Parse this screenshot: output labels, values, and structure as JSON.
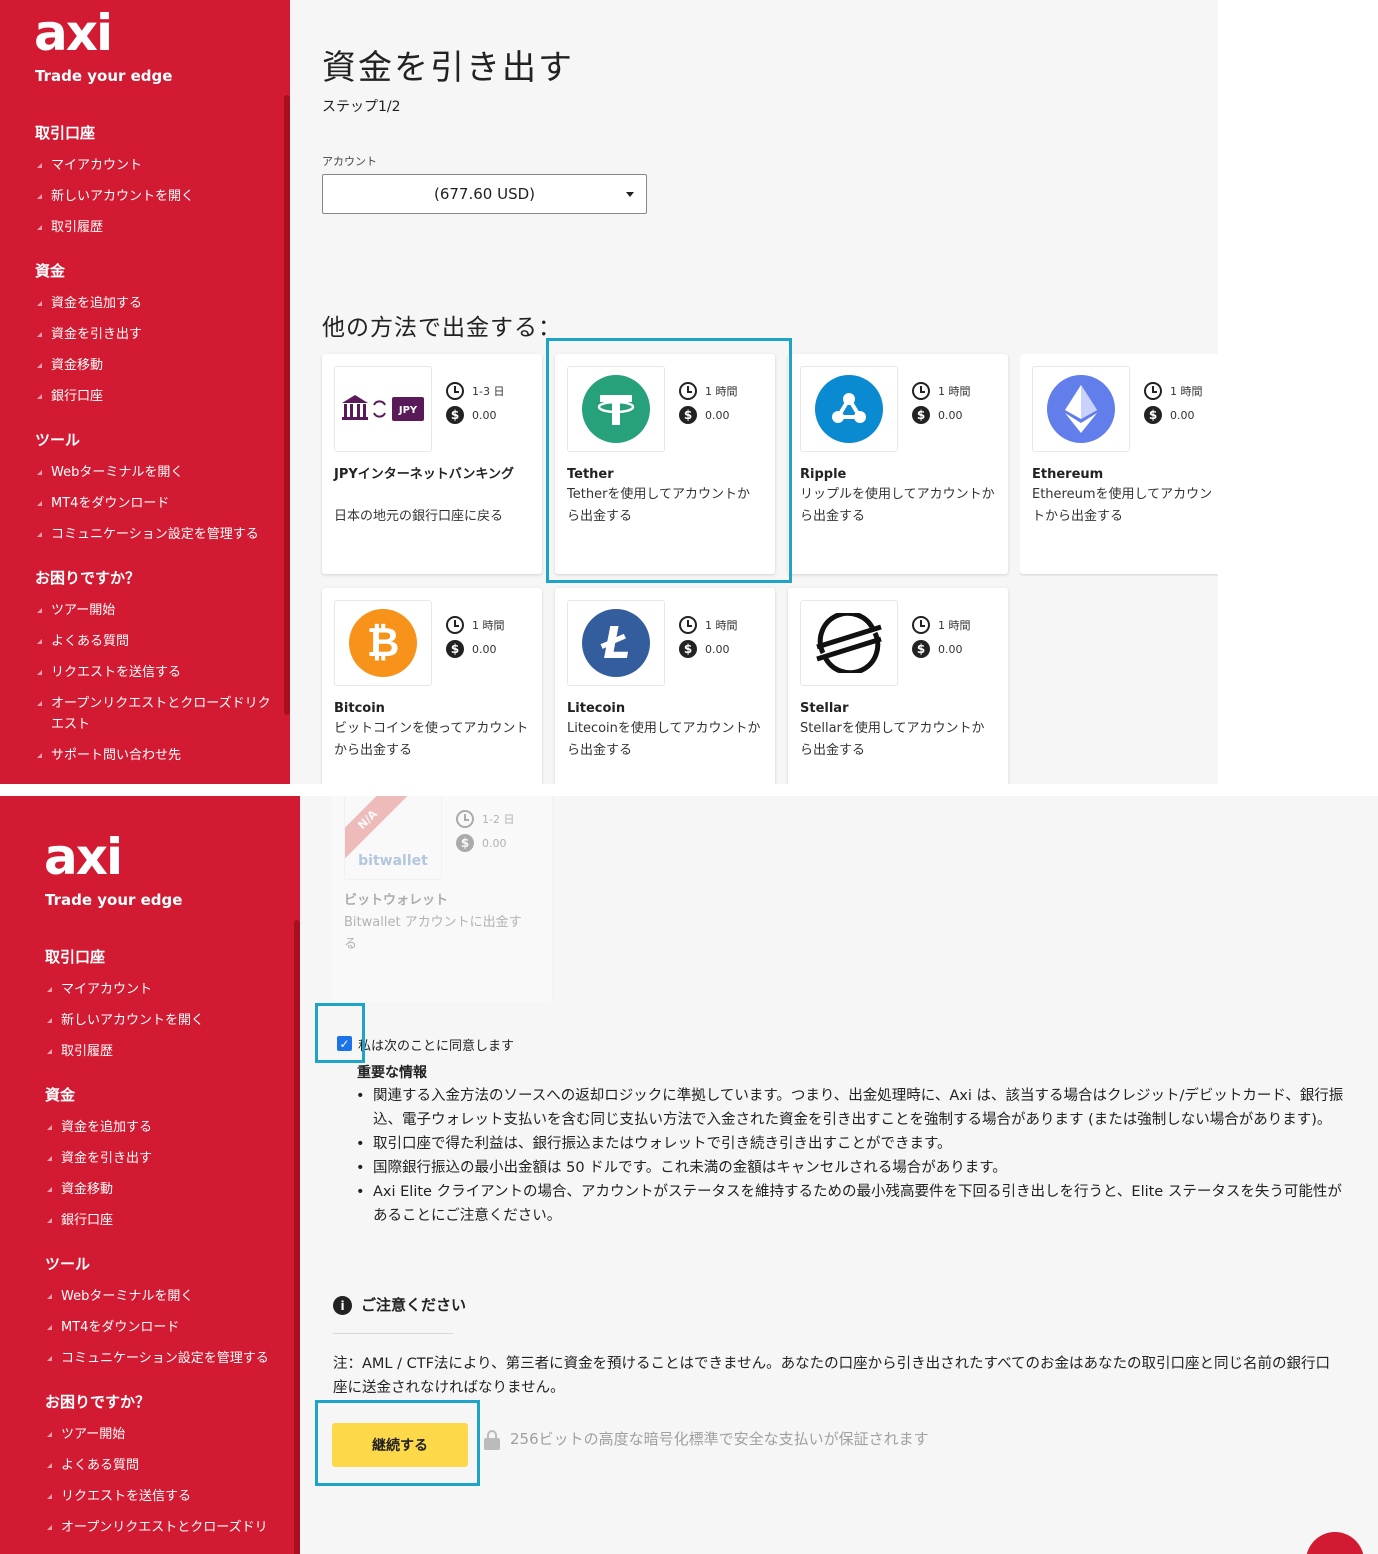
{
  "brand": {
    "logo": "axi",
    "tagline": "Trade your edge"
  },
  "sidebar": [
    {
      "section": "取引口座",
      "items": [
        "マイアカウント",
        "新しいアカウントを開く",
        "取引履歴"
      ]
    },
    {
      "section": "資金",
      "items": [
        "資金を追加する",
        "資金を引き出す",
        "資金移動",
        "銀行口座"
      ]
    },
    {
      "section": "ツール",
      "items": [
        "Webターミナルを開く",
        "MT4をダウンロード",
        "コミュニケーション設定を管理する"
      ]
    },
    {
      "section": "お困りですか？",
      "items": [
        "ツアー開始",
        "よくある質問",
        "リクエストを送信する",
        "オープンリクエストとクローズドリクエスト",
        "サポート問い合わせ先"
      ]
    }
  ],
  "sidebar2_last": "オープンリクエストとクローズドリ",
  "page": {
    "title": "資金を引き出す",
    "step": "ステップ1/2",
    "account_label": "アカウント",
    "account_value": "(677.60 USD)",
    "other_methods_title": "他の方法で出金する："
  },
  "methods": [
    {
      "name": "JPYインターネットバンキング",
      "desc": "日本の地元の銀行口座に戻る",
      "time": "1-3 日",
      "fee": "0.00",
      "icon": "bank-jpy-icon"
    },
    {
      "name": "Tether",
      "desc": "Tetherを使用してアカウントから出金する",
      "time": "1 時間",
      "fee": "0.00",
      "icon": "tether-icon"
    },
    {
      "name": "Ripple",
      "desc": "リップルを使用してアカウントから出金する",
      "time": "1 時間",
      "fee": "0.00",
      "icon": "ripple-icon"
    },
    {
      "name": "Ethereum",
      "desc": "Ethereumを使用してアカウントから出金する",
      "time": "1 時間",
      "fee": "0.00",
      "icon": "ethereum-icon"
    },
    {
      "name": "Bitcoin",
      "desc": "ビットコインを使ってアカウントから出金する",
      "time": "1 時間",
      "fee": "0.00",
      "icon": "bitcoin-icon"
    },
    {
      "name": "Litecoin",
      "desc": "Litecoinを使用してアカウントから出金する",
      "time": "1 時間",
      "fee": "0.00",
      "icon": "litecoin-icon"
    },
    {
      "name": "Stellar",
      "desc": "Stellarを使用してアカウントから出金する",
      "time": "1 時間",
      "fee": "0.00",
      "icon": "stellar-icon"
    },
    {
      "name": "ビットウォレット",
      "desc": "Bitwallet アカウントに出金する",
      "time": "1-2 日",
      "fee": "0.00",
      "icon": "bitwallet-icon",
      "badge": "N/A",
      "logo_text": "bitwallet"
    }
  ],
  "agreement": {
    "label": "私は次のことに同意します",
    "important_title": "重要な情報",
    "points": [
      "関連する入金方法のソースへの返却ロジックに準拠しています。つまり、出金処理時に、Axi は、該当する場合はクレジット/デビットカード、銀行振込、電子ウォレット支払いを含む同じ支払い方法で入金された資金を引き出すことを強制する場合があります (または強制しない場合があります)。",
      "取引口座で得た利益は、銀行振込またはウォレットで引き続き引き出すことができます。",
      "国際銀行振込の最小出金額は 50 ドルです。これ未満の金額はキャンセルされる場合があります。",
      "Axi Elite クライアントの場合、アカウントがステータスを維持するための最小残高要件を下回る引き出しを行うと、Elite ステータスを失う可能性があることにご注意ください。"
    ]
  },
  "notice": {
    "title": "ご注意ください",
    "text": "注：AML / CTF法により、第三者に資金を預けることはできません。あなたの口座から引き出されたすべてのお金はあなたの取引口座と同じ名前の銀行口座に送金されなければなりません。"
  },
  "continue_label": "継続する",
  "secure_text": "256ビットの高度な暗号化標準で安全な支払いが保証されます",
  "icons": {
    "clock": "clock-icon",
    "fee": "dollar-icon",
    "info": "info-icon",
    "lock": "lock-icon"
  },
  "colors": {
    "sidebar": "#d21a32",
    "highlight": "#1ea4c8",
    "button": "#fdd848",
    "tether": "#26a17b",
    "ripple": "#0a8ad1",
    "ethereum": "#627eea",
    "bitcoin": "#f7931a",
    "litecoin": "#345d9d"
  }
}
